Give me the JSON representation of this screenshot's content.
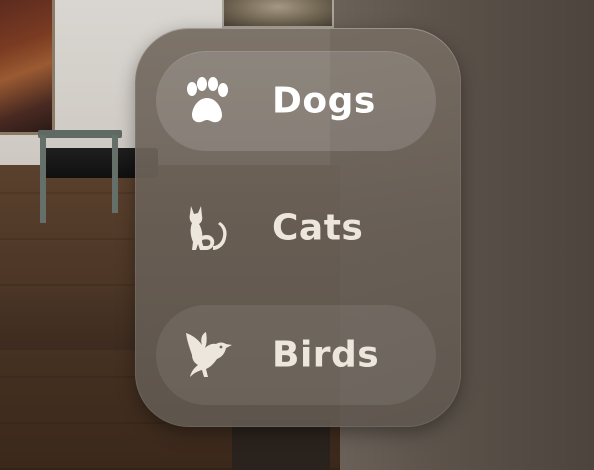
{
  "menu": {
    "items": [
      {
        "label": "Dogs",
        "icon": "paw-icon",
        "selected": true
      },
      {
        "label": "Cats",
        "icon": "cat-icon",
        "selected": false
      },
      {
        "label": "Birds",
        "icon": "bird-icon",
        "selected": false
      }
    ]
  },
  "colors": {
    "panel_background": "#6b6259",
    "selected_item_highlight": "#8a827a",
    "label_text": "#f2efea"
  }
}
